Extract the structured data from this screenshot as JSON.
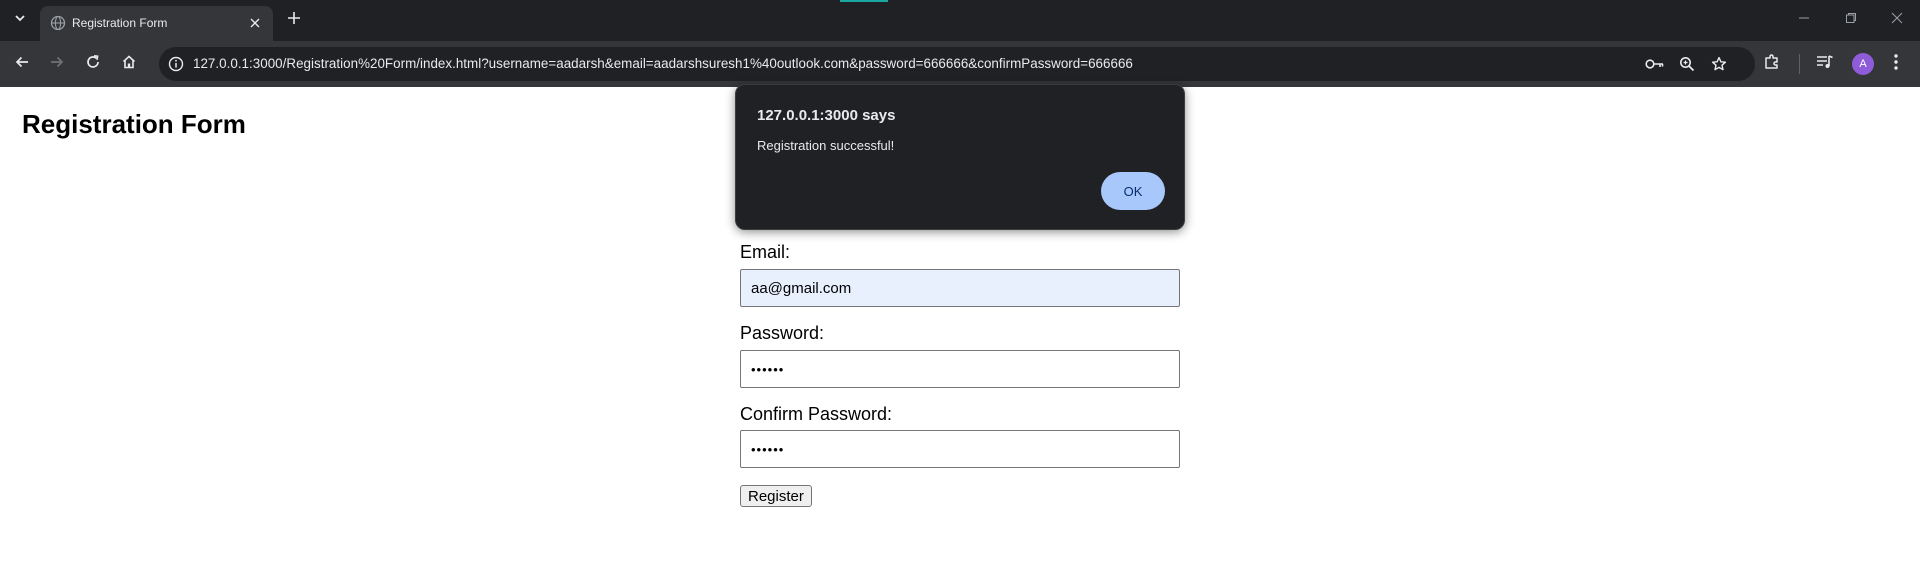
{
  "browser": {
    "tab_title": "Registration Form",
    "url": "127.0.0.1:3000/Registration%20Form/index.html?username=aadarsh&email=aadarshsuresh1%40outlook.com&password=666666&confirmPassword=666666",
    "profile_initial": "A"
  },
  "page": {
    "title": "Registration Form",
    "email_label": "Email:",
    "email_value": "aa@gmail.com",
    "password_label": "Password:",
    "password_value": "••••••",
    "confirm_label": "Confirm Password:",
    "confirm_value": "••••••",
    "register_label": "Register"
  },
  "dialog": {
    "heading": "127.0.0.1:3000 says",
    "message": "Registration successful!",
    "ok_label": "OK"
  },
  "icons": {
    "tab_search": "chevron-down-icon",
    "favicon": "globe-icon",
    "close": "close-icon",
    "new_tab": "plus-icon",
    "back": "back-arrow-icon",
    "forward": "forward-arrow-icon",
    "reload": "reload-icon",
    "home": "home-icon",
    "site_info": "info-icon",
    "password_key": "key-icon",
    "zoom": "zoom-icon",
    "bookmark": "star-icon",
    "extensions": "puzzle-icon",
    "reading_list": "media-list-icon",
    "menu": "kebab-menu-icon"
  },
  "colors": {
    "ok_button": "#a8c7fa",
    "avatar": "#8e5cd9",
    "autofill": "#e8f0fe"
  }
}
